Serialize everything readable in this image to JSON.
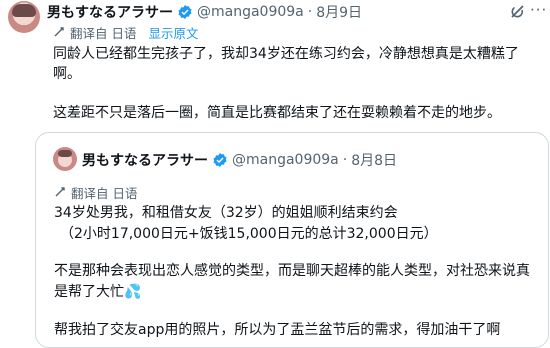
{
  "tweet": {
    "author_name": "男もすなるアラサー",
    "handle": "@manga0909a",
    "separator": "·",
    "time": "8月9日",
    "translated_from": "翻译自 日语",
    "show_original": "显示原文",
    "paragraph_1": "同龄人已经都生完孩子了，我却34岁还在练习约会，冷静想想真是太糟糕了啊。",
    "paragraph_2": "这差距不只是落后一圈，简直是比赛都结束了还在耍赖赖着不走的地步。"
  },
  "quoted_tweet": {
    "author_name": "男もすなるアラサー",
    "handle": "@manga0909a",
    "separator": "·",
    "time": "8月8日",
    "translated_from": "翻译自 日语",
    "line_1": "34岁处男我，和租借女友（32岁）的姐姐顺利结束约会",
    "line_2": "（2小时17,000日元+饭钱15,000日元的总计32,000日元）",
    "paragraph_2": "不是那种会表现出恋人感觉的类型，而是聊天超棒的能人类型，对社恐来说真是帮了大忙💦",
    "paragraph_3": "帮我拍了交友app用的照片，所以为了盂兰盆节后的需求，得加油干了啊"
  },
  "colors": {
    "verified": "#1d9bf0",
    "link": "#1d9bf0",
    "secondary_text": "#536471",
    "border": "#cfd9de"
  },
  "icons": [
    "avatar",
    "verified-badge-icon",
    "grok-icon",
    "more-icon",
    "translate-icon"
  ]
}
